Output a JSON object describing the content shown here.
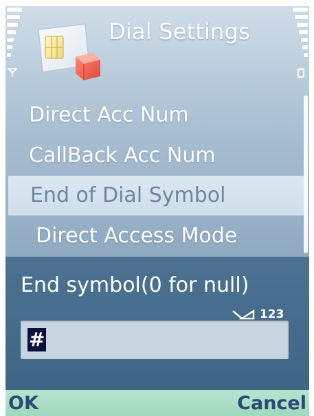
{
  "title_bar": {
    "title": "Dial Settings",
    "app_icon": "sim-card-icon"
  },
  "status": {
    "signal_icon": "antenna-icon",
    "battery_icon": "battery-icon"
  },
  "settings_list": {
    "items": [
      {
        "label": "Direct Acc Num",
        "selected": false
      },
      {
        "label": "CallBack Acc Num",
        "selected": false
      },
      {
        "label": "End of Dial Symbol",
        "selected": true
      },
      {
        "label": "Direct Access Mode",
        "selected": false
      }
    ]
  },
  "dialog": {
    "prompt": "End symbol(0 for null)",
    "input_mode": "123",
    "input_value": "#"
  },
  "softkeys": {
    "left": "OK",
    "right": "Cancel"
  },
  "colors": {
    "dialog_bg": "#4d7291",
    "selection_bg": "#dce8f1",
    "softkey_bg": "#b7e4d0",
    "softkey_text": "#2c4a74"
  }
}
